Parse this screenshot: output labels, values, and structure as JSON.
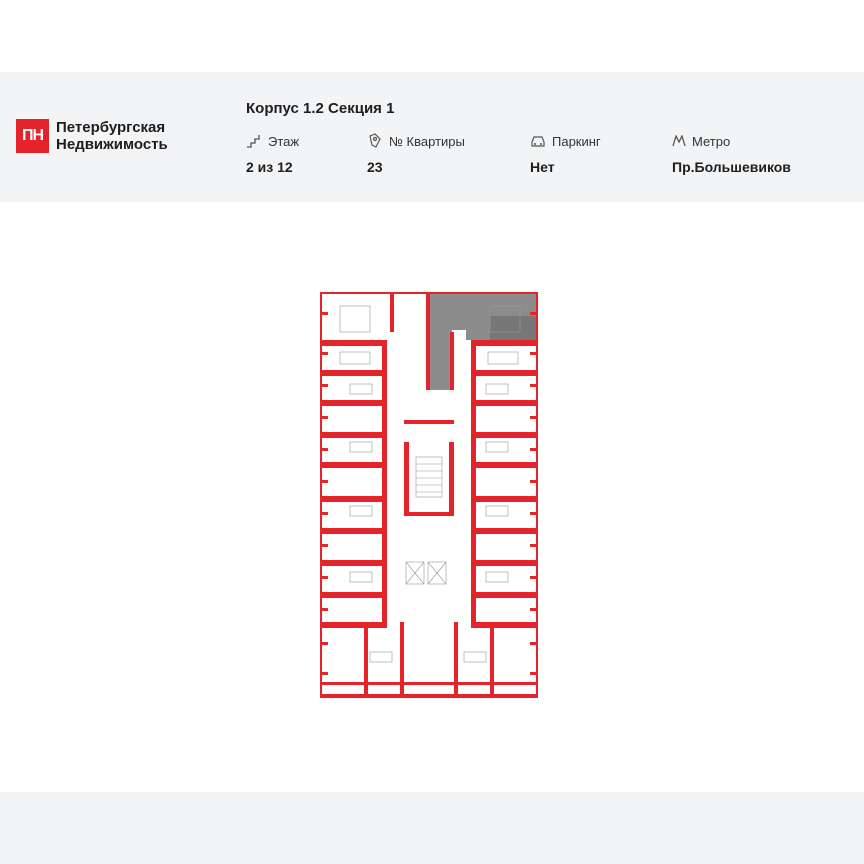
{
  "logo": {
    "mark": "ПН",
    "line1": "Петербургская",
    "line2": "Недвижимость"
  },
  "title": "Корпус 1.2 Секция 1",
  "info": [
    {
      "label": "Этаж",
      "value": "2 из 12",
      "icon": "stairs-icon"
    },
    {
      "label": "№ Квартиры",
      "value": "23",
      "icon": "key-icon"
    },
    {
      "label": "Паркинг",
      "value": "Нет",
      "icon": "car-icon"
    },
    {
      "label": "Метро",
      "value": "Пр.Большевиков",
      "icon": "metro-icon"
    }
  ],
  "colors": {
    "accent": "#e4232b",
    "header_bg": "#f3f4f6",
    "highlight": "#8c8c8c"
  },
  "plan": {
    "description_icon": "floor-plan-image"
  }
}
